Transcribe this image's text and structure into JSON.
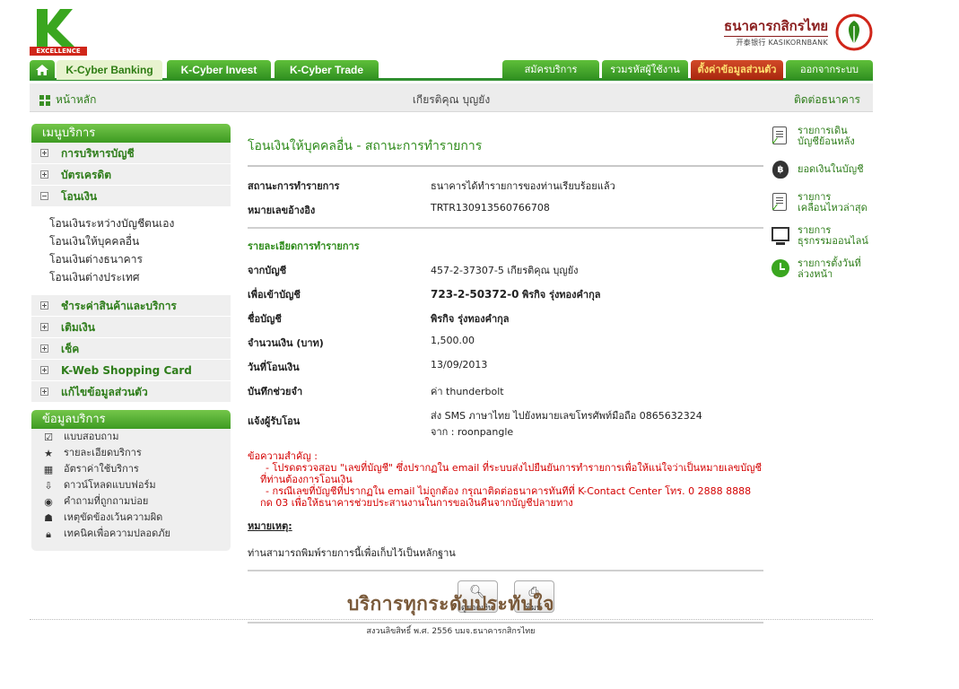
{
  "header": {
    "logo_k": "K",
    "logo_excellence": "EXCELLENCE",
    "bank_name_th": "ธนาคารกสิกรไทย",
    "bank_name_en": "开泰银行 KASIKORNBANK"
  },
  "nav": {
    "tabs_left": [
      "K-Cyber Banking",
      "K-Cyber Invest",
      "K-Cyber Trade"
    ],
    "tabs_right": [
      "สมัครบริการ",
      "รวมรหัสผู้ใช้งาน",
      "ตั้งค่าข้อมูลส่วนตัว",
      "ออกจากระบบ"
    ]
  },
  "subbar": {
    "home": "หน้าหลัก",
    "user": "เกียรติคุณ บุญยัง",
    "contact": "ติดต่อธนาคาร"
  },
  "sidebar": {
    "menu_title": "เมนูบริการ",
    "menu_top": [
      "การบริหารบัญชี",
      "บัตรเครดิต",
      "โอนเงิน"
    ],
    "submenu": [
      "โอนเงินระหว่างบัญชีตนเอง",
      "โอนเงินให้บุคคลอื่น",
      "โอนเงินต่างธนาคาร",
      "โอนเงินต่างประเทศ"
    ],
    "menu_bottom": [
      "ชำระค่าสินค้าและบริการ",
      "เติมเงิน",
      "เช็ค",
      "K-Web Shopping Card",
      "แก้ไขข้อมูลส่วนตัว"
    ],
    "info_title": "ข้อมูลบริการ",
    "info_items": [
      "แบบสอบถาม",
      "รายละเอียดบริการ",
      "อัตราค่าใช้บริการ",
      "ดาวน์โหลดแบบฟอร์ม",
      "คำถามที่ถูกถามบ่อย",
      "เหตุขัดข้องเว้นความผิด",
      "เทคนิคเพื่อความปลอดภัย"
    ]
  },
  "main": {
    "title": "โอนเงินให้บุคคลอื่น - สถานะการทำรายการ",
    "status_label": "สถานะการทำรายการ",
    "status_value": "ธนาคารได้ทำรายการของท่านเรียบร้อยแล้ว",
    "ref_label": "หมายเลขอ้างอิง",
    "ref_value": "TRTR130913560766708",
    "details_title": "รายละเอียดการทำรายการ",
    "from_label": "จากบัญชี",
    "from_value": "457-2-37307-5 เกียรติคุณ บุญยัง",
    "to_label": "เพื่อเข้าบัญชี",
    "to_account": "723-2-50372-0",
    "to_name": "พิรกิจ รุ่งทองคำกุล",
    "acct_name_label": "ชื่อบัญชี",
    "acct_name_value": "พิรกิจ รุ่งทองคำกุล",
    "amount_label": "จำนวนเงิน (บาท)",
    "amount_value": "1,500.00",
    "date_label": "วันที่โอนเงิน",
    "date_value": "13/09/2013",
    "memo_label": "บันทึกช่วยจำ",
    "memo_value": "ค่า thunderbolt",
    "notify_label": "แจ้งผู้รับโอน",
    "notify_value_1": "ส่ง SMS ภาษาไทย ไปยังหมายเลขโทรศัพท์มือถือ 0865632324",
    "notify_value_2": "จาก : roonpangle",
    "warn_title": "ข้อความสำคัญ :",
    "warn_1": "- โปรดตรวจสอบ \"เลขที่บัญชี\" ซึ่งปรากฏใน email ที่ระบบส่งไปยืนยันการทำรายการเพื่อให้แน่ใจว่าเป็นหมายเลขบัญชีที่ท่านต้องการโอนเงิน",
    "warn_2": "- กรณีเลขที่บัญชีที่ปรากฏใน email ไม่ถูกต้อง กรุณาติดต่อธนาคารทันทีที่ K-Contact Center โทร. 0 2888 8888 กด 03 เพื่อให้ธนาคารช่วยประสานงานในการขอเงินคืนจากบัญชีปลายทาง",
    "note_title": "หมายเหตุ:",
    "note_text": "ท่านสามารถพิมพ์รายการนี้เพื่อเก็บไว้เป็นหลักฐาน",
    "btn_balance": "ดูยอดเงิน",
    "btn_print": "พิมพ์"
  },
  "rightbar": {
    "links": [
      [
        "รายการเดิน",
        "บัญชีย้อนหลัง"
      ],
      [
        "ยอดเงินในบัญชี"
      ],
      [
        "รายการ",
        "เคลื่อนไหวล่าสุด"
      ],
      [
        "รายการ",
        "ธุรกรรมออนไลน์"
      ],
      [
        "รายการตั้งวันที่",
        "ล่วงหน้า"
      ]
    ]
  },
  "footer": {
    "slogan": "บริการทุกระดับประทับใจ",
    "copyright": "สงวนลิขสิทธิ์ พ.ศ. 2556 บมจ.ธนาคารกสิกรไทย"
  },
  "colors": {
    "brand_green": "#2e8b1a",
    "warn_red": "#d40000",
    "tab_red": "#b8300f"
  }
}
